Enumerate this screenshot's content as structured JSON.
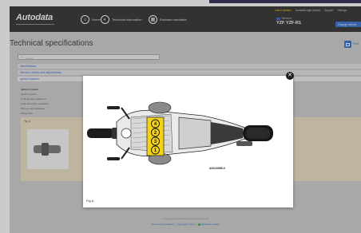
{
  "header": {
    "logo": "Autodata",
    "nav": [
      {
        "icon": "home-icon",
        "glyph": "⌂",
        "label": "Home"
      },
      {
        "icon": "compass-icon",
        "glyph": "◐",
        "label": "Technical information"
      },
      {
        "icon": "calculator-icon",
        "glyph": "▦",
        "label": "Estimate calculator"
      }
    ],
    "top_links": [
      "Latest updates",
      "Autodata login (demo)",
      "Support",
      "Settings"
    ],
    "vehicle": {
      "brand": "Yamaha",
      "model": "YZF YZF-R1"
    },
    "change_vehicle": "Change vehicle"
  },
  "page": {
    "title": "Technical specifications",
    "print_label": "Print",
    "search_placeholder": "Search",
    "sections": [
      "Identification",
      "Service checks and adjustments",
      "Ignition system"
    ],
    "ignition_rows": [
      "Ignition system",
      "Ignition system",
      "Cold primary resistance",
      "Cold secondary resistance",
      "Pick-up coil resistance",
      "Firing order"
    ],
    "figure_label": "Fig. A"
  },
  "footer": {
    "copyright": "© copyright Autodata Ltd. All rights reserved",
    "links": [
      "Terms and conditions",
      "Copyright notice",
      "Application status"
    ]
  },
  "modal": {
    "firing_order": [
      "4",
      "2",
      "3",
      "1"
    ],
    "ref_code": "AD010989-0",
    "figure_label": "Fig.A"
  },
  "colors": {
    "accent": "#2f6fd0",
    "header": "#2c2c2c",
    "highlight": "#f2d21a",
    "figure_bg": "#efdfbf"
  }
}
